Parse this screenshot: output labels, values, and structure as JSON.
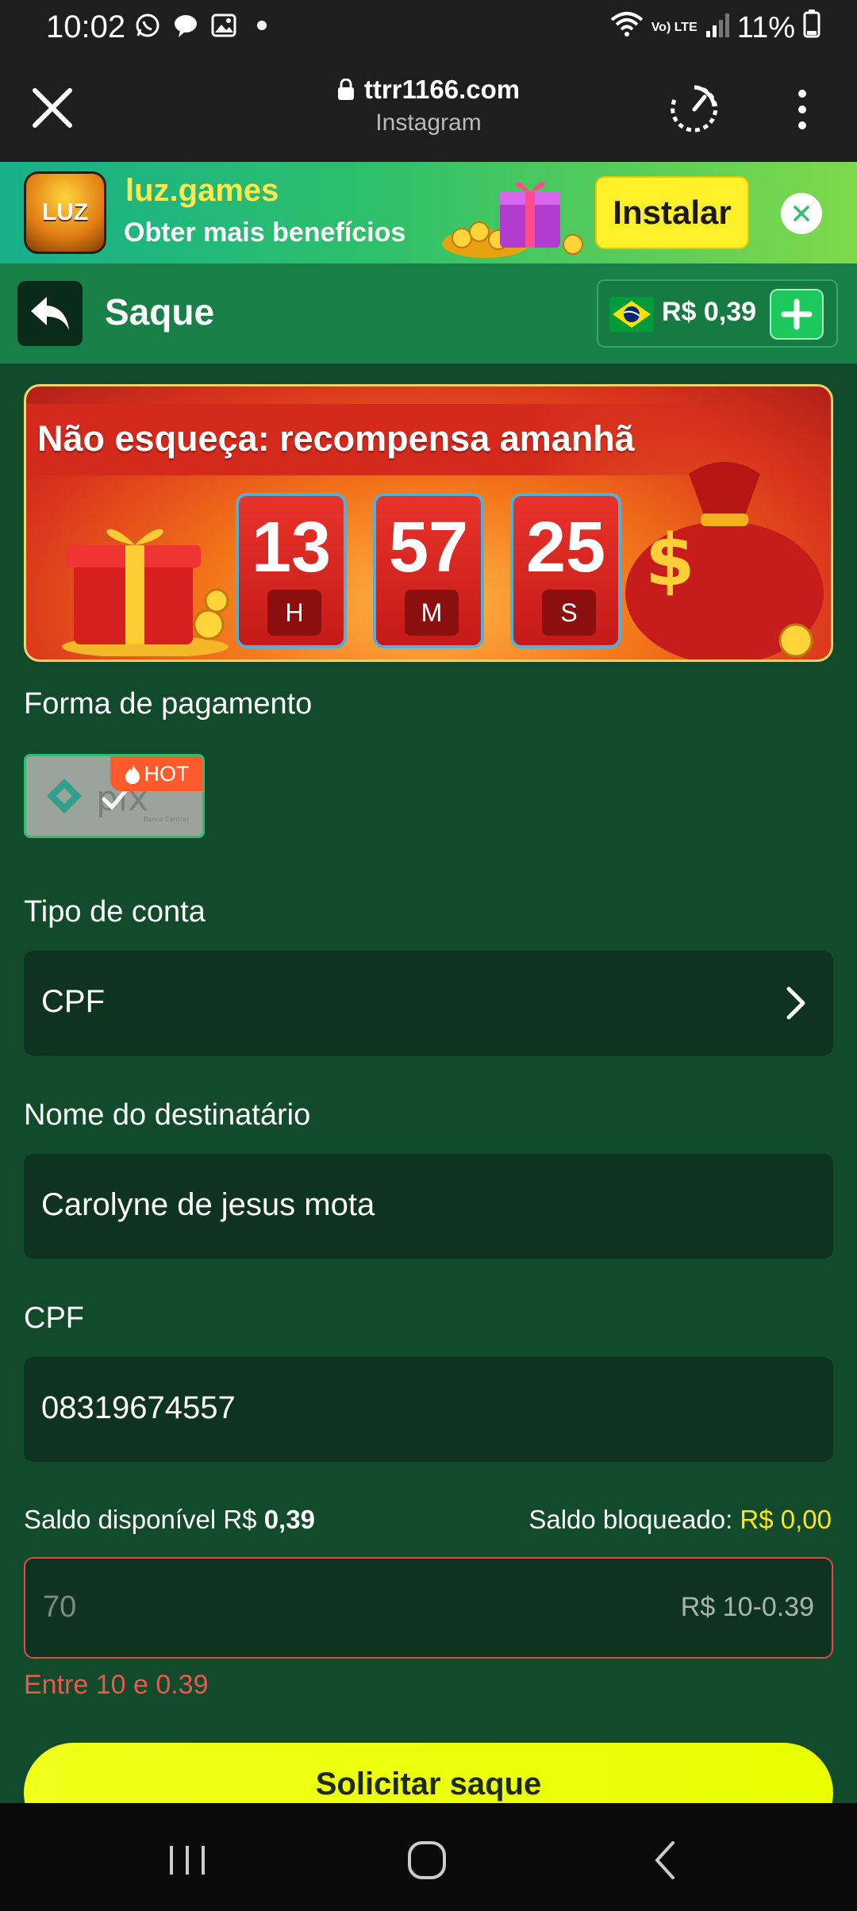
{
  "status_bar": {
    "time": "10:02",
    "battery": "11%",
    "network": "Vo) LTE",
    "icons": [
      "whatsapp-icon",
      "chat-icon",
      "gallery-icon",
      "dot-icon",
      "wifi-icon",
      "signal-icon",
      "battery-icon"
    ]
  },
  "browser": {
    "url": "ttrr1166.com",
    "subtitle": "Instagram"
  },
  "install_banner": {
    "app_name": "luz.games",
    "tagline": "Obter mais benefícios",
    "install_label": "Instalar",
    "icon_text": "LUZ"
  },
  "header": {
    "title": "Saque",
    "balance": "R$ 0,39"
  },
  "promo": {
    "title": "Não esqueça: recompensa amanhã",
    "hours": "13",
    "minutes": "57",
    "seconds": "25",
    "hours_unit": "H",
    "minutes_unit": "M",
    "seconds_unit": "S"
  },
  "form": {
    "payment_label": "Forma de pagamento",
    "pix_badge": "HOT",
    "account_type_label": "Tipo de conta",
    "account_type_value": "CPF",
    "recipient_label": "Nome do destinatário",
    "recipient_value": "Carolyne de jesus mota",
    "cpf_label": "CPF",
    "cpf_value": "08319674557",
    "available_label": "Saldo disponível R$ ",
    "available_value": "0,39",
    "blocked_label": "Saldo bloqueado: ",
    "blocked_value": "R$ 0,00",
    "amount_placeholder": "70",
    "amount_range": "R$ 10-0.39",
    "error": "Entre 10 e 0.39",
    "submit_label": "Solicitar saque"
  },
  "colors": {
    "page_bg": "#124a2c",
    "header_bg": "#188047",
    "submit": "#eaff10",
    "error": "#e85a4f",
    "highlight": "#ffe812"
  }
}
